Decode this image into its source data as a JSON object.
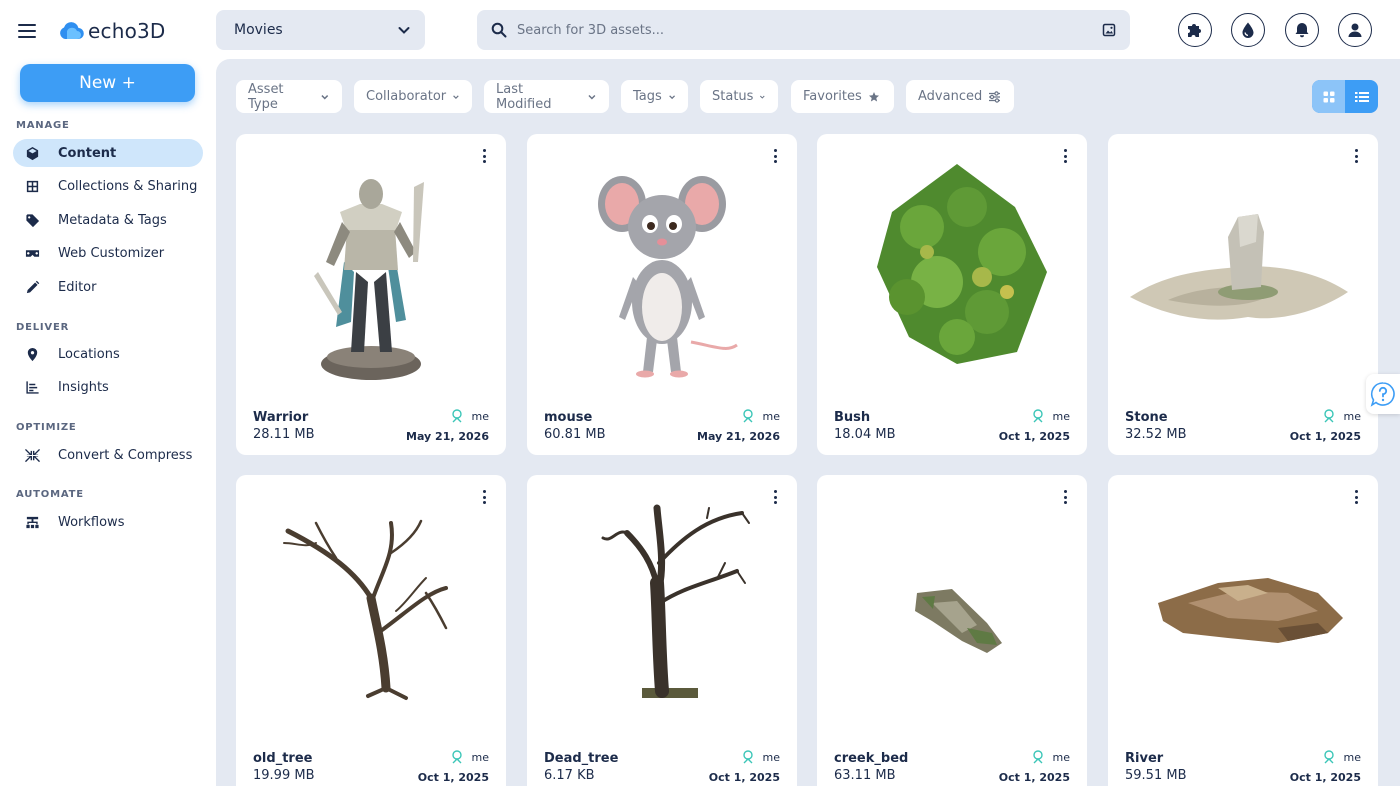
{
  "app": {
    "name": "echo3D"
  },
  "sidebar": {
    "new_button": "New +",
    "sections": {
      "manage": "MANAGE",
      "deliver": "DELIVER",
      "optimize": "OPTIMIZE",
      "automate": "AUTOMATE"
    },
    "items": {
      "content": "Content",
      "collections": "Collections & Sharing",
      "metadata": "Metadata & Tags",
      "web_customizer": "Web Customizer",
      "editor": "Editor",
      "locations": "Locations",
      "insights": "Insights",
      "convert": "Convert & Compress",
      "workflows": "Workflows"
    }
  },
  "topbar": {
    "project": "Movies",
    "search_placeholder": "Search for 3D assets..."
  },
  "filters": {
    "asset_type": "Asset Type",
    "collaborator": "Collaborator",
    "last_modified": "Last Modified",
    "tags": "Tags",
    "status": "Status",
    "favorites": "Favorites",
    "advanced": "Advanced"
  },
  "assets": [
    {
      "name": "Warrior",
      "size": "28.11 MB",
      "owner": "me",
      "date": "May 21, 2026"
    },
    {
      "name": "mouse",
      "size": "60.81 MB",
      "owner": "me",
      "date": "May 21, 2026"
    },
    {
      "name": "Bush",
      "size": "18.04 MB",
      "owner": "me",
      "date": "Oct 1, 2025"
    },
    {
      "name": "Stone",
      "size": "32.52 MB",
      "owner": "me",
      "date": "Oct 1, 2025"
    },
    {
      "name": "old_tree",
      "size": "19.99 MB",
      "owner": "me",
      "date": "Oct 1, 2025"
    },
    {
      "name": "Dead_tree",
      "size": "6.17 KB",
      "owner": "me",
      "date": "Oct 1, 2025"
    },
    {
      "name": "creek_bed",
      "size": "63.11 MB",
      "owner": "me",
      "date": "Oct 1, 2025"
    },
    {
      "name": "River",
      "size": "59.51 MB",
      "owner": "me",
      "date": "Oct 1, 2025"
    }
  ],
  "colors": {
    "accent": "#3d9df5",
    "active_nav": "#cfe6fb",
    "workspace_bg": "#e4e9f2",
    "text": "#1c2b4a",
    "owner_icon": "#3cc6b8"
  }
}
